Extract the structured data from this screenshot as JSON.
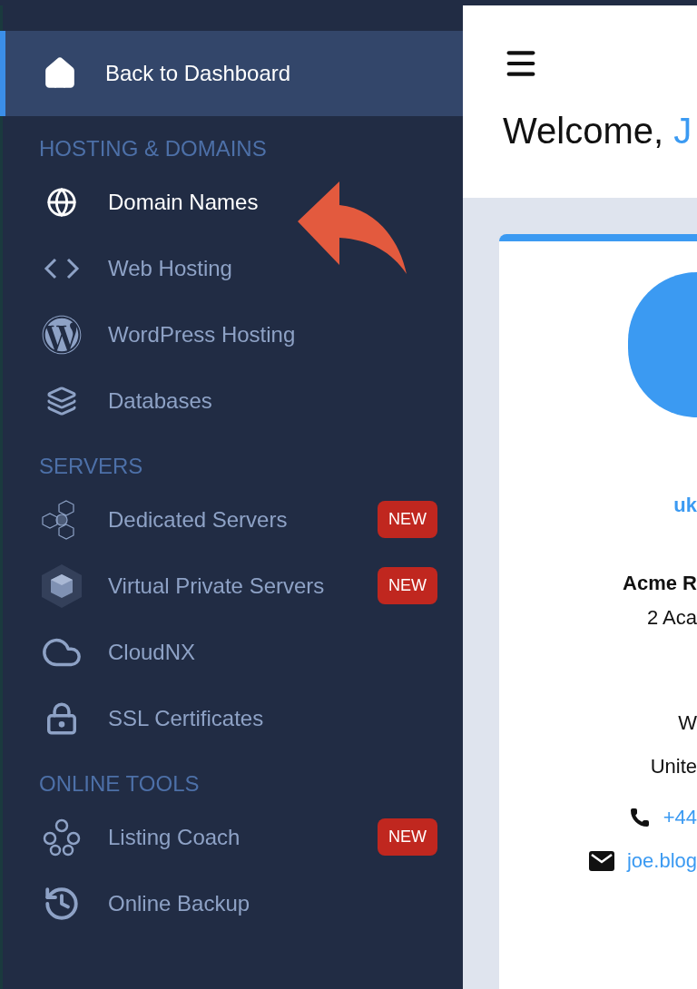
{
  "sidebar": {
    "back_link": {
      "label": "Back to Dashboard"
    },
    "sections": [
      {
        "heading": "HOSTING & DOMAINS",
        "items": [
          {
            "label": "Domain Names",
            "kind": "globe",
            "selected": true
          },
          {
            "label": "Web Hosting",
            "kind": "code",
            "selected": false
          },
          {
            "label": "WordPress Hosting",
            "kind": "wordpress",
            "selected": false
          },
          {
            "label": "Databases",
            "kind": "layers",
            "selected": false
          }
        ]
      },
      {
        "heading": "SERVERS",
        "items": [
          {
            "label": "Dedicated Servers",
            "kind": "cubes",
            "selected": false,
            "badge": "NEW"
          },
          {
            "label": "Virtual Private Servers",
            "kind": "hexcube",
            "selected": false,
            "badge": "NEW"
          },
          {
            "label": "CloudNX",
            "kind": "cloud",
            "selected": false
          },
          {
            "label": "SSL Certificates",
            "kind": "lock",
            "selected": false
          }
        ]
      },
      {
        "heading": "ONLINE TOOLS",
        "items": [
          {
            "label": "Listing Coach",
            "kind": "pins",
            "selected": false,
            "badge": "NEW"
          },
          {
            "label": "Online Backup",
            "kind": "history",
            "selected": false
          }
        ]
      }
    ]
  },
  "header": {
    "greeting": "Welcome,",
    "name": "J"
  },
  "profile_card": {
    "username": "uk",
    "company": "Acme R",
    "address_lines": [
      "2 Aca",
      "W",
      "Unite"
    ],
    "phone": "+44",
    "email": "joe.blog"
  }
}
